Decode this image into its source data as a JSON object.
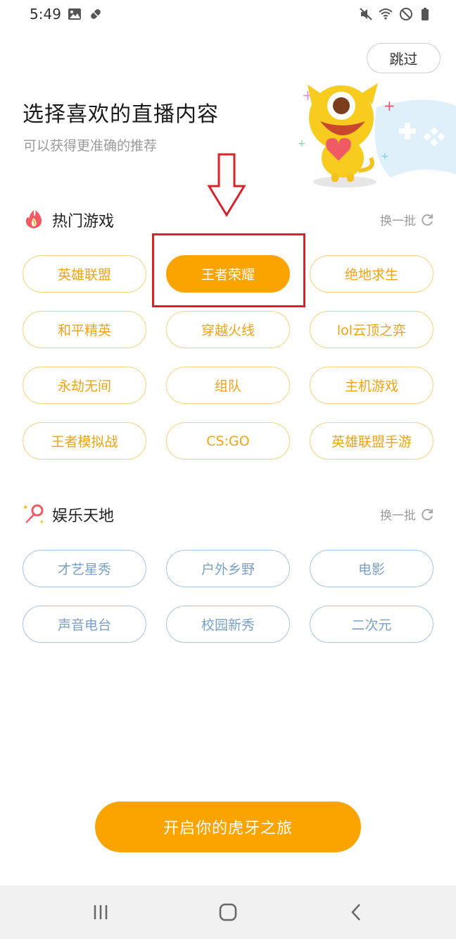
{
  "status_bar": {
    "time": "5:49",
    "icons": [
      "image-icon",
      "pill-icon",
      "mute-icon",
      "wifi-icon",
      "do-not-disturb-icon",
      "battery-icon"
    ]
  },
  "skip_label": "跳过",
  "header": {
    "title": "选择喜欢的直播内容",
    "subtitle": "可以获得更准确的推荐"
  },
  "colors": {
    "accent": "#fba400",
    "game_text": "#f0a312",
    "ent_text": "#7ba0c8",
    "highlight": "#d8232a"
  },
  "hot_games": {
    "title": "热门游戏",
    "refresh_label": "换一批",
    "items": [
      {
        "label": "英雄联盟",
        "selected": false
      },
      {
        "label": "王者荣耀",
        "selected": true
      },
      {
        "label": "绝地求生",
        "selected": false
      },
      {
        "label": "和平精英",
        "selected": false
      },
      {
        "label": "穿越火线",
        "selected": false
      },
      {
        "label": "lol云顶之弈",
        "selected": false
      },
      {
        "label": "永劫无间",
        "selected": false
      },
      {
        "label": "组队",
        "selected": false
      },
      {
        "label": "主机游戏",
        "selected": false
      },
      {
        "label": "王者模拟战",
        "selected": false
      },
      {
        "label": "CS:GO",
        "selected": false
      },
      {
        "label": "英雄联盟手游",
        "selected": false
      }
    ]
  },
  "entertainment": {
    "title": "娱乐天地",
    "refresh_label": "换一批",
    "items": [
      {
        "label": "才艺星秀"
      },
      {
        "label": "户外乡野"
      },
      {
        "label": "电影"
      },
      {
        "label": "声音电台"
      },
      {
        "label": "校园新秀"
      },
      {
        "label": "二次元"
      }
    ]
  },
  "cta_label": "开启你的虎牙之旅"
}
